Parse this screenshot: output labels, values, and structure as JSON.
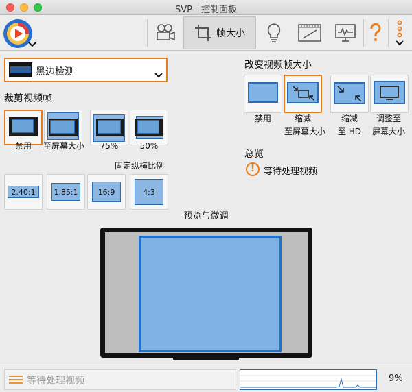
{
  "window": {
    "title": "SVP - 控制面板"
  },
  "toolbar": {
    "active_tab_label": "帧大小",
    "more_label": "⋮"
  },
  "crop": {
    "dropdown_label": "黑边检测",
    "section_title": "裁剪视频帧",
    "options": [
      {
        "label": "禁用"
      },
      {
        "label": "至屏幕大小"
      },
      {
        "label": "75%"
      },
      {
        "label": "50%"
      }
    ],
    "aspect_title": "固定纵横比例",
    "aspect_options": [
      {
        "label": "2.40:1"
      },
      {
        "label": "1.85:1"
      },
      {
        "label": "16:9"
      },
      {
        "label": "4:3"
      }
    ]
  },
  "resize": {
    "section_title": "改变视频帧大小",
    "options": [
      {
        "line1": "禁用",
        "line2": ""
      },
      {
        "line1": "缩减",
        "line2": "至屏幕大小"
      },
      {
        "line1": "缩减",
        "line2": "至 HD"
      },
      {
        "line1": "调整至",
        "line2": "屏幕大小"
      }
    ]
  },
  "summary": {
    "section_title": "总览",
    "status": "等待处理视频"
  },
  "preview": {
    "title": "预览与微调"
  },
  "statusbar": {
    "text": "等待处理视频",
    "cpu": "9%"
  },
  "colors": {
    "accent": "#e87d1f",
    "screen_blue": "#7fb2e5",
    "frame_blue": "#1f73cc"
  }
}
